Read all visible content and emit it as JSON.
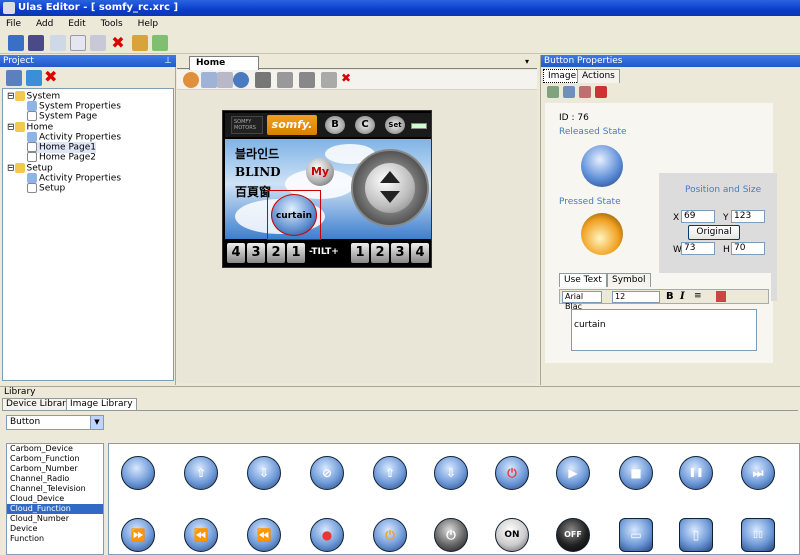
{
  "window": {
    "title": "Ulas Editor - [ somfy_rc.xrc ]"
  },
  "menu": [
    "File",
    "Add",
    "Edit",
    "Tools",
    "Help"
  ],
  "project": {
    "title": "Project",
    "tree": [
      {
        "label": "System",
        "level": 0
      },
      {
        "label": "System Properties",
        "level": 2
      },
      {
        "label": "System Page",
        "level": 2
      },
      {
        "label": "Home",
        "level": 0
      },
      {
        "label": "Activity Properties",
        "level": 2
      },
      {
        "label": "Home Page1",
        "level": 2,
        "selected": true
      },
      {
        "label": "Home Page2",
        "level": 2
      },
      {
        "label": "Setup",
        "level": 0
      },
      {
        "label": "Activity Properties",
        "level": 2
      },
      {
        "label": "Setup",
        "level": 2
      }
    ]
  },
  "document": {
    "tab": "Home Page1",
    "device": {
      "brand": "somfy.",
      "logo_text": "SOMFY MOTORS",
      "top_buttons": [
        "B",
        "C",
        "Set"
      ],
      "korean": [
        "블라인드",
        "BLIND",
        "百頁窗"
      ],
      "my_label": "My",
      "curtain_label": "curtain",
      "tilt_label": "-TILT+",
      "left_numbers": [
        "4",
        "3",
        "2",
        "1"
      ],
      "right_numbers": [
        "1",
        "2",
        "3",
        "4"
      ]
    }
  },
  "properties": {
    "title": "Button Properties",
    "tabs": [
      "Image",
      "Actions"
    ],
    "id_label": "ID : 76",
    "released_label": "Released State",
    "pressed_label": "Pressed State",
    "position_label": "Position and Size",
    "x_label": "X",
    "x_value": "69",
    "y_label": "Y",
    "y_value": "123",
    "w_label": "W",
    "w_value": "73",
    "h_label": "H",
    "h_value": "70",
    "original_button": "Original",
    "text_tabs": [
      "Use Text",
      "Symbol"
    ],
    "font_name": "Arial Blac",
    "font_size": "12",
    "text_value": "curtain"
  },
  "library": {
    "title": "Library",
    "tabs": [
      "Device Library",
      "Image Library"
    ],
    "combo_value": "Button",
    "categories": [
      "Carbom_Device",
      "Carbom_Function",
      "Carbom_Number",
      "Channel_Radio",
      "Channel_Television",
      "Cloud_Device",
      "Cloud_Function",
      "Cloud_Number",
      "Device",
      "Function"
    ],
    "selected_category": "Cloud_Function",
    "row1_glyphs": [
      "",
      "⇧",
      "⇩",
      "⊘",
      "⇧",
      "⇩",
      "⏻",
      "▶",
      "■",
      "❚❚",
      "⏭"
    ],
    "row2_glyphs": [
      "⏩",
      "⏪",
      "⏪",
      "●",
      "⏻",
      "⏻",
      "ON",
      "OFF",
      "▭",
      "▯",
      "▯▯"
    ]
  },
  "colors": {
    "title_bar": "#0a3ec9",
    "panel_header": "#2458c8",
    "selection": "#316ac5",
    "accent_orange": "#f0a020"
  }
}
